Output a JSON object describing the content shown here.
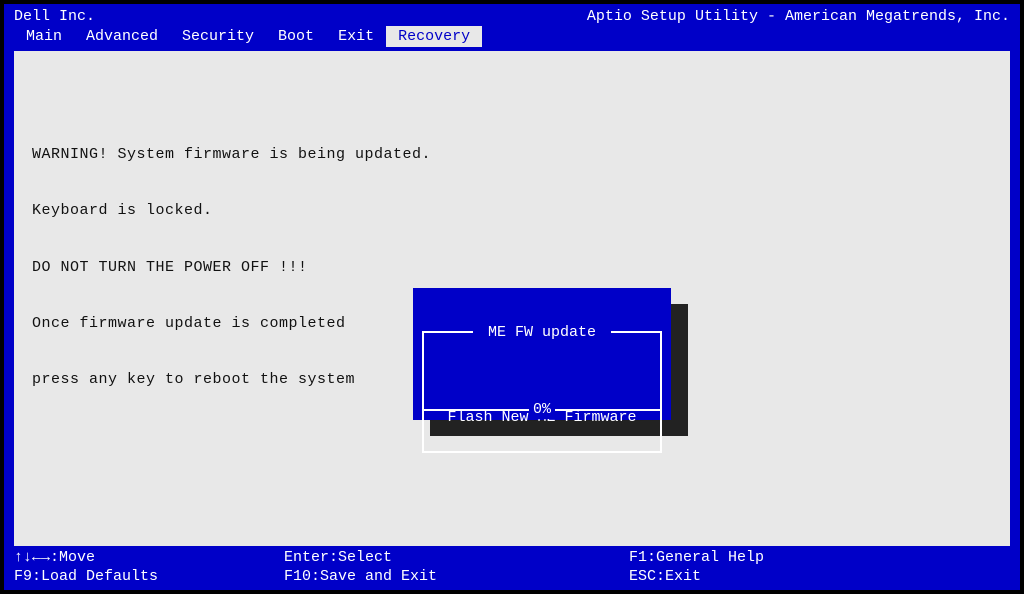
{
  "header": {
    "vendor": "Dell Inc.",
    "utility": "Aptio Setup Utility - American Megatrends, Inc."
  },
  "menu": {
    "items": [
      "Main",
      "Advanced",
      "Security",
      "Boot",
      "Exit",
      "Recovery"
    ],
    "active_index": 5
  },
  "warning": {
    "line1": "WARNING! System firmware is being updated.",
    "line2": "Keyboard is locked.",
    "line3": "DO NOT TURN THE POWER OFF !!!",
    "line4": "Once firmware update is completed",
    "line5": "press any key to reboot the system"
  },
  "dialog": {
    "title": " ME FW update ",
    "message": "Flash New ME Firmware",
    "progress_label": "0%",
    "progress_value": 0
  },
  "footer": {
    "move": "↑↓←→:Move",
    "load_defaults": "F9:Load Defaults",
    "select": "Enter:Select",
    "save_exit": "F10:Save and Exit",
    "help": "F1:General Help",
    "exit": "ESC:Exit"
  }
}
